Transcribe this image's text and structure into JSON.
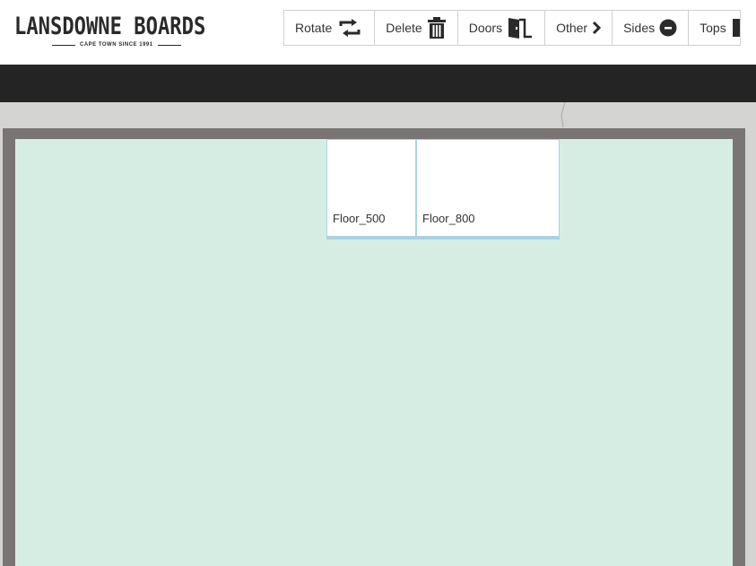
{
  "logo": {
    "title": "LANSDOWNE BOARDS",
    "tagline": "CAPE TOWN SINCE 1991"
  },
  "toolbar": {
    "buttons": [
      {
        "label": "Rotate",
        "icon": "rotate-icon"
      },
      {
        "label": "Delete",
        "icon": "trash-icon"
      },
      {
        "label": "Doors",
        "icon": "door-icon"
      },
      {
        "label": "Other",
        "icon": "chevron-right-icon"
      },
      {
        "label": "Sides",
        "icon": "minus-circle-icon"
      },
      {
        "label": "Tops",
        "icon": "tops-icon"
      }
    ]
  },
  "floor": {
    "boards": [
      {
        "label": "Floor_500"
      },
      {
        "label": "Floor_800"
      }
    ]
  },
  "colors": {
    "floor": "#d6ede4",
    "frame": "#787574",
    "nav_bar": "#242424",
    "board_border": "#a8d3e3"
  }
}
